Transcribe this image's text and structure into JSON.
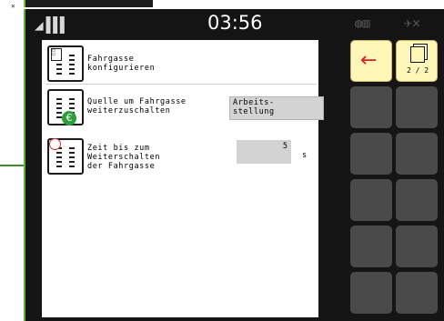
{
  "statusbar": {
    "clock": "03:56"
  },
  "rows": [
    {
      "label": "Fahrgasse\nkonfigurieren"
    },
    {
      "label": "Quelle um Fahrgasse\nweiterzuschalten",
      "value": "Arbeits-\nstellung"
    },
    {
      "label": "Zeit bis zum\nWeiterschalten\nder Fahrgasse",
      "value": "5",
      "unit": "s"
    }
  ],
  "buttons": {
    "back": {
      "icon": "arrow-left-icon",
      "color": "#e11b1b"
    },
    "page": {
      "icon": "pages-icon",
      "label": "2 / 2"
    }
  },
  "colors": {
    "frame": "#151515",
    "accent_green": "#5fb23a",
    "active_button": "#fff7b8",
    "idle_button": "#4a4a4a",
    "value_box": "#d3d3d3"
  }
}
